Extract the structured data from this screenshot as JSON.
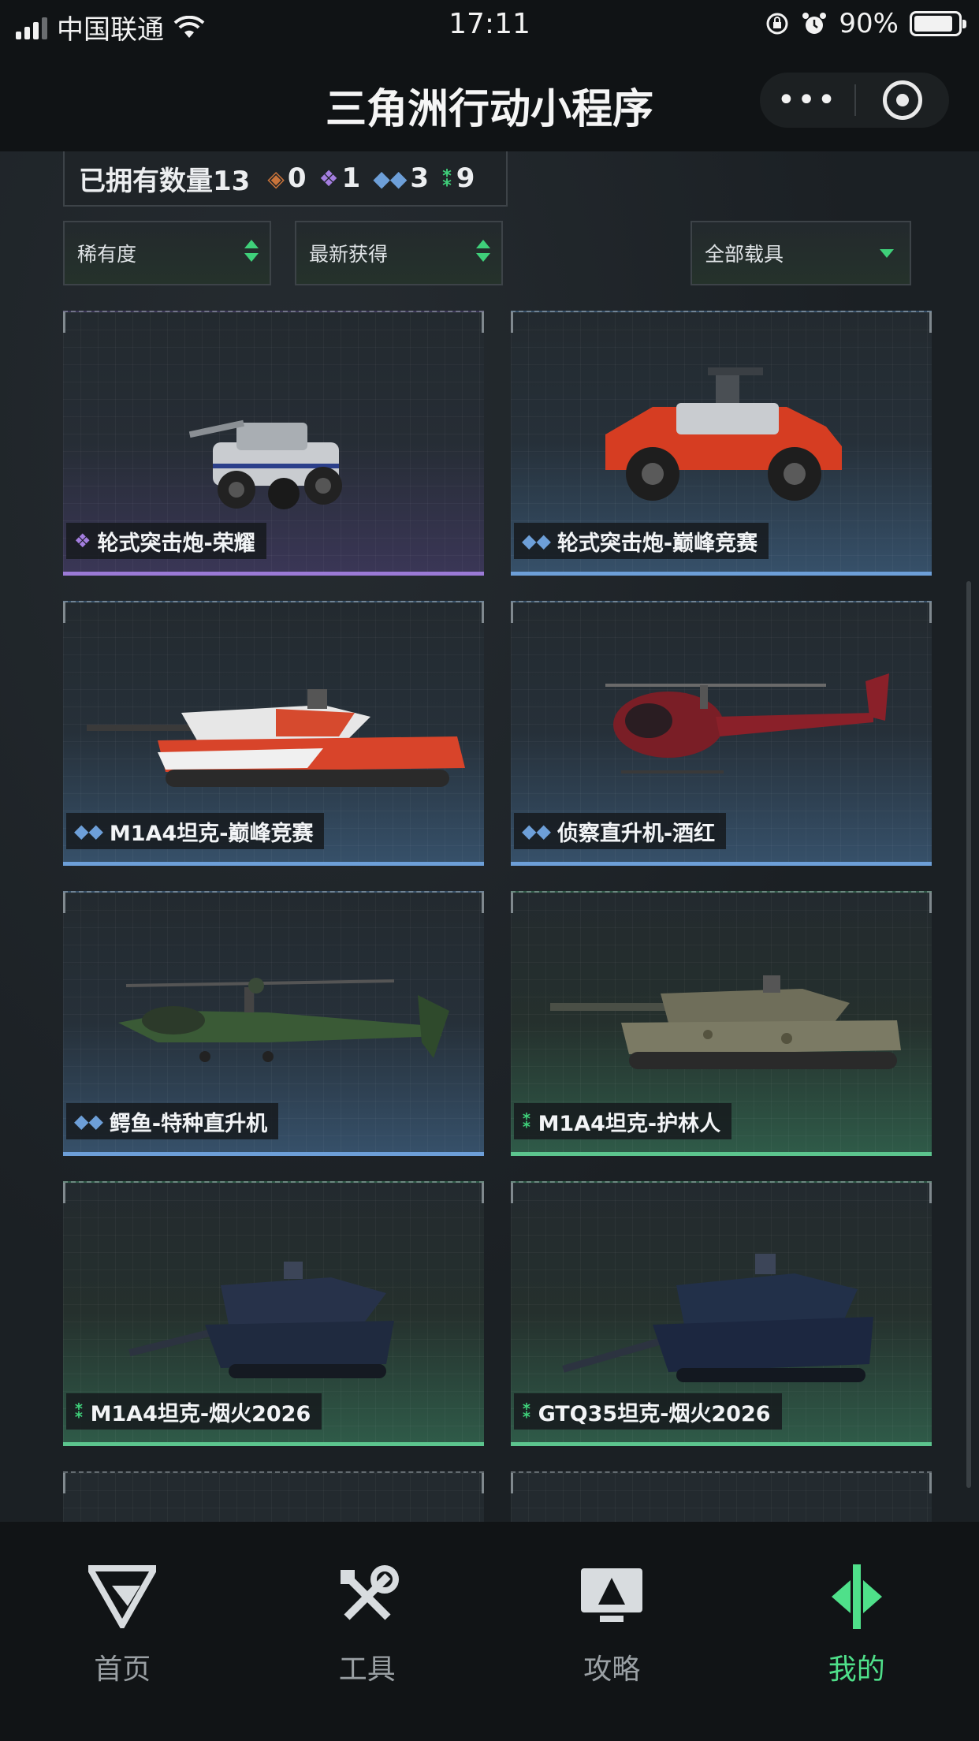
{
  "status_bar": {
    "carrier": "中国联通",
    "time": "17:11",
    "battery": "90%"
  },
  "header": {
    "title": "三角洲行动小程序",
    "more_glyph": "•••"
  },
  "owned": {
    "label": "已拥有数量13",
    "rarity_counts": [
      {
        "value": "0",
        "color": "#c8733a",
        "icon": "orange-diamond-icon"
      },
      {
        "value": "1",
        "color": "#a47ee0",
        "icon": "purple-diamond-icon"
      },
      {
        "value": "3",
        "color": "#6d9fd8",
        "icon": "blue-diamond-icon"
      },
      {
        "value": "9",
        "color": "#3fd07a",
        "icon": "green-diamond-icon"
      }
    ]
  },
  "filters": {
    "rarity": "稀有度",
    "sort": "最新获得",
    "vehicle_type": "全部载具"
  },
  "vehicles": [
    {
      "name": "轮式突击炮-荣耀",
      "rarity": "purple",
      "icon": "purple-diamond-icon"
    },
    {
      "name": "轮式突击炮-巅峰竞赛",
      "rarity": "blue",
      "icon": "blue-diamond-icon"
    },
    {
      "name": "M1A4坦克-巅峰竞赛",
      "rarity": "blue",
      "icon": "blue-diamond-icon"
    },
    {
      "name": "侦察直升机-酒红",
      "rarity": "blue",
      "icon": "blue-diamond-icon"
    },
    {
      "name": "鳄鱼-特种直升机",
      "rarity": "blue",
      "icon": "blue-diamond-icon"
    },
    {
      "name": "M1A4坦克-护林人",
      "rarity": "green",
      "icon": "green-diamond-icon"
    },
    {
      "name": "M1A4坦克-烟火2026",
      "rarity": "green",
      "icon": "green-diamond-icon"
    },
    {
      "name": "GTQ35坦克-烟火2026",
      "rarity": "green",
      "icon": "green-diamond-icon"
    }
  ],
  "nav": [
    {
      "label": "首页",
      "icon": "delta-logo-icon"
    },
    {
      "label": "工具",
      "icon": "wrench-screwdriver-icon"
    },
    {
      "label": "攻略",
      "icon": "monitor-guide-icon"
    },
    {
      "label": "我的",
      "icon": "profile-emblem-icon",
      "active": true
    }
  ],
  "colors": {
    "accent": "#4fe08a",
    "purple": "#9b7ad6",
    "blue": "#6d9fd8",
    "green": "#5cc58e"
  }
}
